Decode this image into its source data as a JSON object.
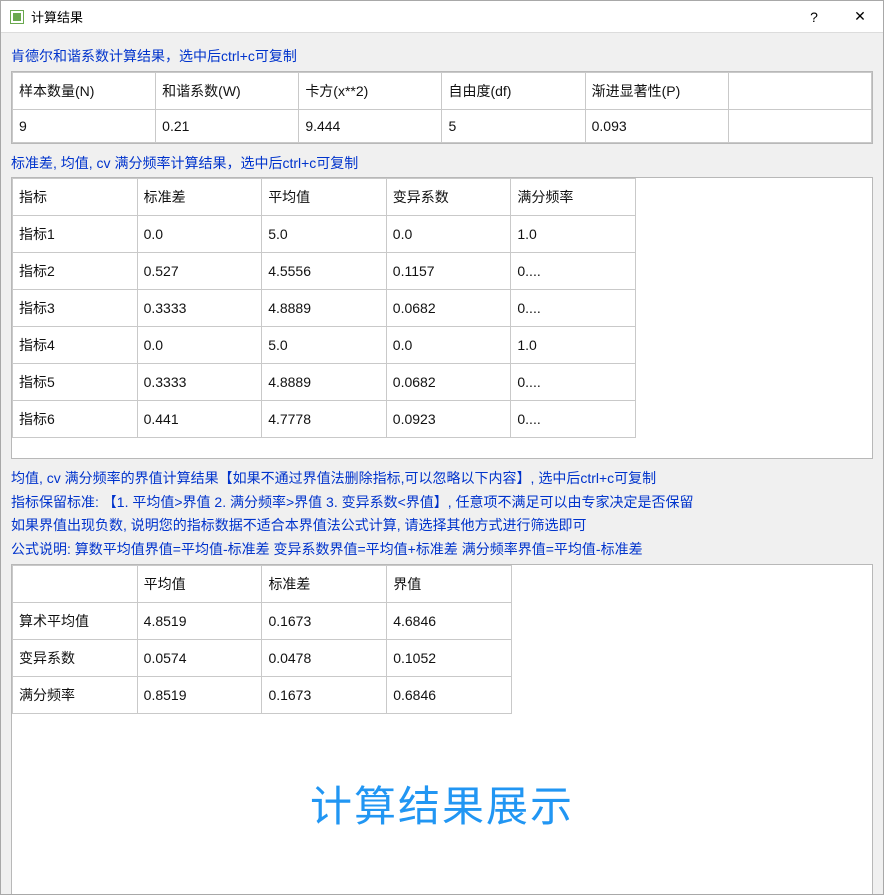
{
  "window": {
    "title": "计算结果"
  },
  "section1": {
    "label": "肯德尔和谐系数计算结果，选中后ctrl+c可复制",
    "headers": [
      "样本数量(N)",
      "和谐系数(W)",
      "卡方(x**2)",
      "自由度(df)",
      "渐进显著性(P)"
    ],
    "row": [
      "9",
      "0.21",
      "9.444",
      "5",
      "0.093"
    ]
  },
  "section2": {
    "label": "标准差, 均值, cv 满分频率计算结果，选中后ctrl+c可复制",
    "headers": [
      "指标",
      "标准差",
      "平均值",
      "变异系数",
      "满分频率"
    ],
    "rows": [
      [
        "指标1",
        "0.0",
        "5.0",
        "0.0",
        "1.0"
      ],
      [
        "指标2",
        "0.527",
        "4.5556",
        "0.1157",
        "0...."
      ],
      [
        "指标3",
        "0.3333",
        "4.8889",
        "0.0682",
        "0...."
      ],
      [
        "指标4",
        "0.0",
        "5.0",
        "0.0",
        "1.0"
      ],
      [
        "指标5",
        "0.3333",
        "4.8889",
        "0.0682",
        "0...."
      ],
      [
        "指标6",
        "0.441",
        "4.7778",
        "0.0923",
        "0...."
      ]
    ]
  },
  "section3": {
    "line1": "均值, cv 满分频率的界值计算结果【如果不通过界值法删除指标,可以忽略以下内容】, 选中后ctrl+c可复制",
    "line2": "指标保留标准: 【1. 平均值>界值  2. 满分频率>界值  3. 变异系数<界值】, 任意项不满足可以由专家决定是否保留",
    "line3": "如果界值出现负数, 说明您的指标数据不适合本界值法公式计算, 请选择其他方式进行筛选即可",
    "line4": "公式说明:  算数平均值界值=平均值-标准差   变异系数界值=平均值+标准差  满分频率界值=平均值-标准差",
    "headers": [
      "",
      "平均值",
      "标准差",
      "界值"
    ],
    "rows": [
      [
        "算术平均值",
        "4.8519",
        "0.1673",
        "4.6846"
      ],
      [
        "变异系数",
        "0.0574",
        "0.0478",
        "0.1052"
      ],
      [
        "满分频率",
        "0.8519",
        "0.1673",
        "0.6846"
      ]
    ]
  },
  "bigLabel": "计算结果展示",
  "icons": {
    "help": "?",
    "close": "✕"
  }
}
